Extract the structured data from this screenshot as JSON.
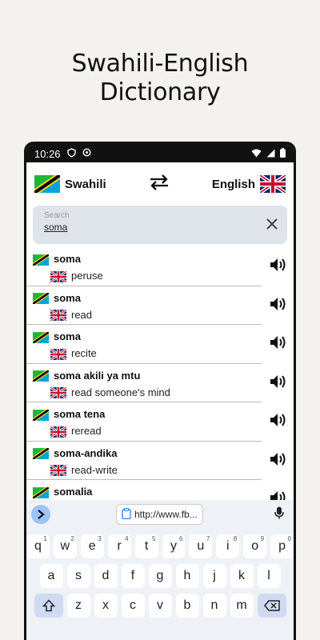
{
  "headline": {
    "line1": "Swahili-English",
    "line2": "Dictionary"
  },
  "status": {
    "time": "10:26"
  },
  "langbar": {
    "source": "Swahili",
    "target": "English"
  },
  "search": {
    "placeholder": "Search",
    "value": "soma"
  },
  "results": [
    {
      "sw": "soma",
      "en": "peruse"
    },
    {
      "sw": "soma",
      "en": "read"
    },
    {
      "sw": "soma",
      "en": "recite"
    },
    {
      "sw": "soma akili ya mtu",
      "en": "read someone's mind"
    },
    {
      "sw": "soma tena",
      "en": "reread"
    },
    {
      "sw": "soma-andika",
      "en": "read-write"
    },
    {
      "sw": "somalia",
      "en": ""
    }
  ],
  "keyboard": {
    "url": "http://www.fb...",
    "row1": [
      {
        "k": "q",
        "n": "1"
      },
      {
        "k": "w",
        "n": "2"
      },
      {
        "k": "e",
        "n": "3"
      },
      {
        "k": "r",
        "n": "4"
      },
      {
        "k": "t",
        "n": "5"
      },
      {
        "k": "y",
        "n": "6"
      },
      {
        "k": "u",
        "n": "7"
      },
      {
        "k": "i",
        "n": "8"
      },
      {
        "k": "o",
        "n": "9"
      },
      {
        "k": "p",
        "n": "0"
      }
    ],
    "row2": [
      "a",
      "s",
      "d",
      "f",
      "g",
      "h",
      "j",
      "k",
      "l"
    ],
    "row3": [
      "z",
      "x",
      "c",
      "v",
      "b",
      "n",
      "m"
    ]
  },
  "colors": {
    "accent": "#9cc3f2",
    "search_bg": "#dfe3ea"
  }
}
